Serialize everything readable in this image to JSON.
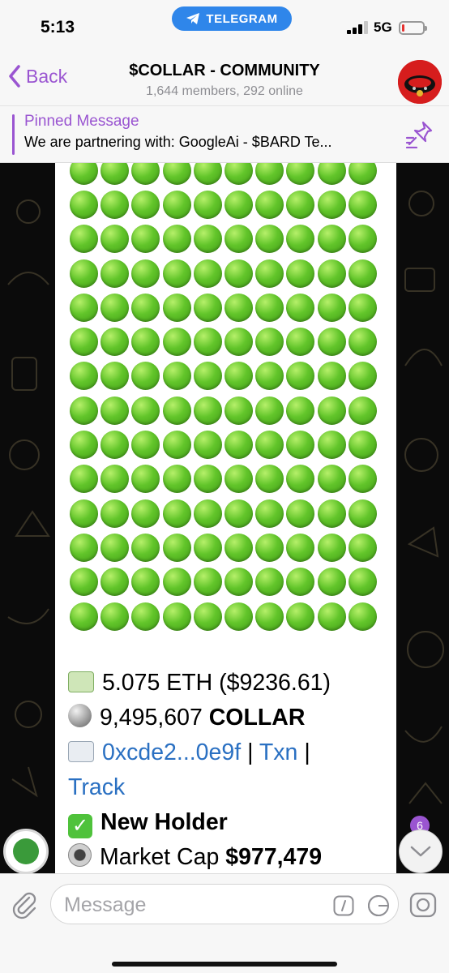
{
  "status_bar": {
    "time": "5:13",
    "app_pill": "TELEGRAM",
    "network": "5G",
    "battery_level": 0.1
  },
  "header": {
    "back_label": "Back",
    "title": "$COLLAR - COMMUNITY",
    "subtitle": "1,644 members, 292 online"
  },
  "pinned": {
    "label": "Pinned Message",
    "text": "We are partnering with: GoogleAi - $BARD Te..."
  },
  "message": {
    "grid": {
      "rows": 14,
      "cols": 10,
      "icon": "green-circle-emoji"
    },
    "eth_amount": "5.075 ETH ($9236.61)",
    "token_amount": "9,495,607",
    "token_symbol": "COLLAR",
    "address": "0xcde2...0e9f",
    "separator": "|",
    "txn_label": "Txn",
    "track_label": "Track",
    "new_holder": "New Holder",
    "market_cap_label": "Market Cap",
    "market_cap_value": "$977,479"
  },
  "scroll_down": {
    "unread_count": "6"
  },
  "composer": {
    "placeholder": "Message"
  },
  "colors": {
    "accent": "#9a55d1",
    "link": "#2a70c2",
    "telegram_blue": "#2f86ea"
  }
}
